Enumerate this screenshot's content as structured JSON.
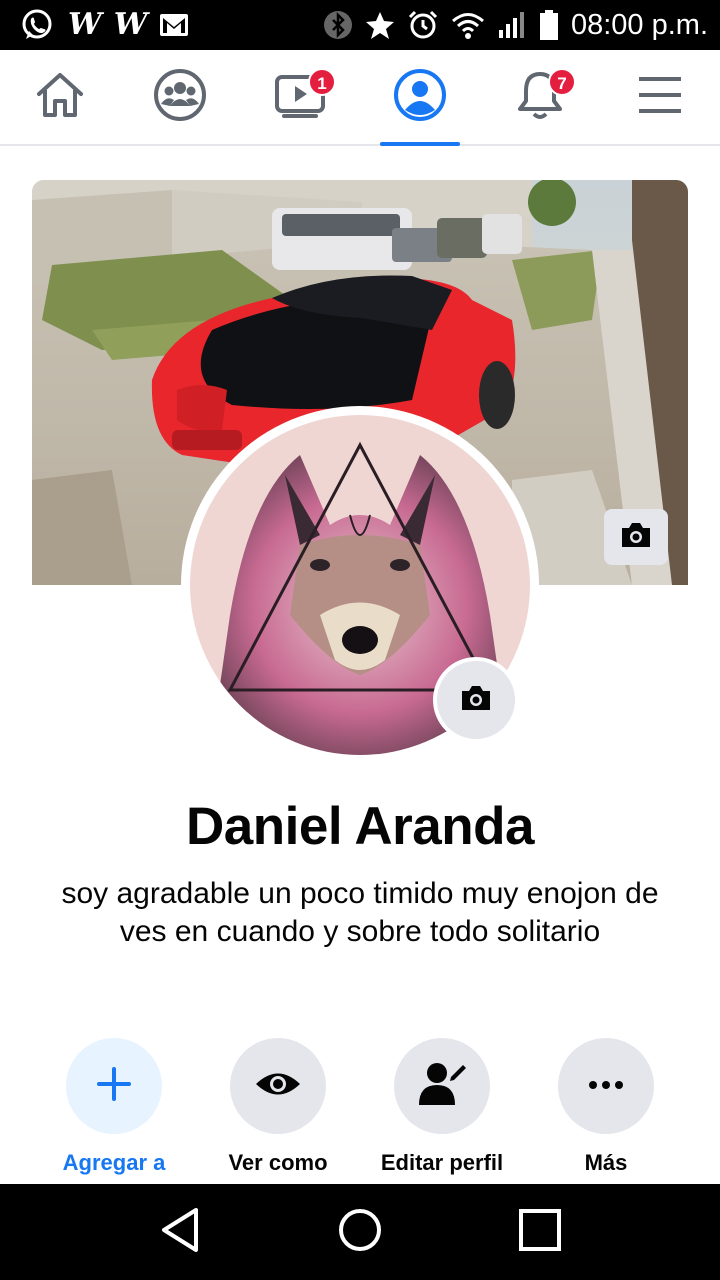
{
  "status_bar": {
    "left_icons": [
      "whatsapp-icon",
      "wattpad-icon",
      "wattpad-icon",
      "gmail-icon"
    ],
    "wattpad_glyph": "W",
    "right_icons": [
      "bluetooth-icon",
      "star-icon",
      "alarm-icon",
      "wifi-icon",
      "signal-icon",
      "battery-icon"
    ],
    "time": "08:00 p.m."
  },
  "nav": {
    "tabs": [
      {
        "name": "home",
        "icon": "home-icon",
        "badge": ""
      },
      {
        "name": "groups",
        "icon": "groups-icon",
        "badge": ""
      },
      {
        "name": "watch",
        "icon": "video-icon",
        "badge": "1"
      },
      {
        "name": "profile",
        "icon": "profile-icon",
        "badge": "",
        "active": true
      },
      {
        "name": "notifications",
        "icon": "bell-icon",
        "badge": "7"
      },
      {
        "name": "menu",
        "icon": "menu-icon",
        "badge": ""
      }
    ],
    "active_color": "#1877f2",
    "badge_color": "#e41e3f"
  },
  "profile": {
    "name": "Daniel Aranda",
    "bio": "soy agradable un poco timido muy enojon de ves en cuando y sobre todo solitario",
    "cover_photo": "photo of a red sports car with a black hood parked on a dirt street",
    "profile_photo": "illustration of a wolf face with a triangle overlay in pink tones"
  },
  "actions": [
    {
      "label": "Agregar a",
      "icon": "plus-icon",
      "primary": true
    },
    {
      "label": "Ver como",
      "icon": "eye-icon",
      "primary": false
    },
    {
      "label": "Editar perfil",
      "icon": "edit-profile-icon",
      "primary": false
    },
    {
      "label": "Más",
      "icon": "more-icon",
      "primary": false
    }
  ],
  "android_nav": [
    "back-icon",
    "home-circle-icon",
    "recents-icon"
  ]
}
